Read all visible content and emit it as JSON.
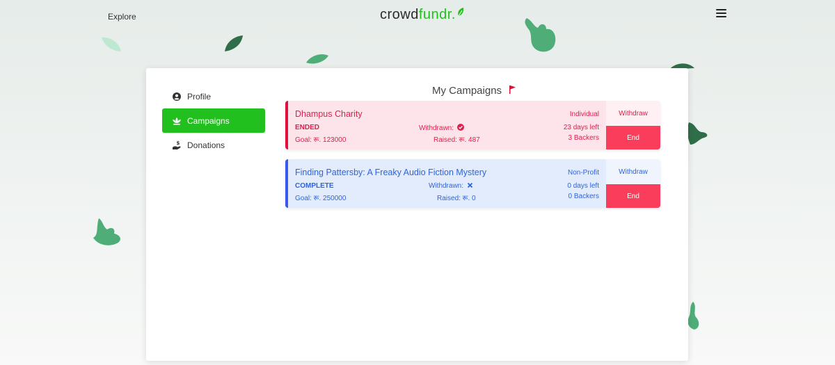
{
  "nav": {
    "explore_label": "Explore",
    "logo_part1": "crowd",
    "logo_part2": "fundr."
  },
  "colors": {
    "brand_green": "#22c01f",
    "end_button": "#fa3d5a",
    "ended_accent": "#e0103c",
    "complete_accent": "#3b57ee"
  },
  "sidebar": {
    "items": [
      {
        "label": "Profile",
        "icon": "user-circle-icon",
        "active": false
      },
      {
        "label": "Campaigns",
        "icon": "lotus-icon",
        "active": true
      },
      {
        "label": "Donations",
        "icon": "hand-donate-icon",
        "active": false
      }
    ]
  },
  "main": {
    "title": "My Campaigns",
    "title_icon": "flag-icon",
    "campaigns": [
      {
        "name": "Dhampus Charity",
        "type": "Individual",
        "status": "ENDED",
        "withdrawn_label": "Withdrawn:",
        "withdrawn_icon": "check-circle-icon",
        "days_left": "23 days left",
        "goal": "Goal: रू. 123000",
        "raised": "Raised: रू. 487",
        "backers": "3 Backers",
        "withdraw_label": "Withdraw",
        "end_label": "End"
      },
      {
        "name": "Finding Pattersby: A Freaky Audio Fiction Mystery",
        "type": "Non-Profit",
        "status": "COMPLETE",
        "withdrawn_label": "Withdrawn:",
        "withdrawn_icon": "x-mark-icon",
        "days_left": "0 days left",
        "goal": "Goal: रू. 250000",
        "raised": "Raised: रू. 0",
        "backers": "0 Backers",
        "withdraw_label": "Withdraw",
        "end_label": "End"
      }
    ]
  }
}
